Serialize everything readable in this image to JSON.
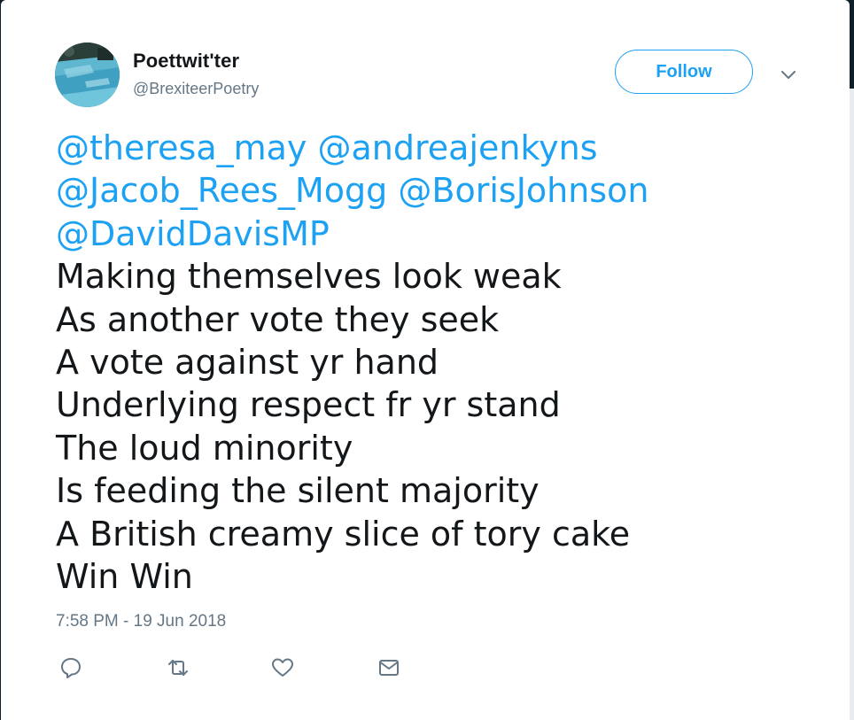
{
  "tweet": {
    "user": {
      "display_name": "Poettwit'ter",
      "screen_name": "@BrexiteerPoetry",
      "avatar_icon": "pool-photo-avatar"
    },
    "follow_label": "Follow",
    "mentions": [
      "@theresa_may",
      "@andreajenkyns",
      "@Jacob_Rees_Mogg",
      "@BorisJohnson",
      "@DavidDavisMP"
    ],
    "lines": [
      "Making themselves look weak",
      "As another vote they seek",
      "A vote against yr hand",
      "Underlying respect fr yr stand",
      "The loud minority",
      "Is feeding the silent majority",
      "A British creamy slice of tory cake",
      "Win Win"
    ],
    "timestamp": "7:58 PM - 19 Jun 2018",
    "actions": [
      "reply-icon",
      "retweet-icon",
      "like-icon",
      "direct-message-icon"
    ]
  },
  "colors": {
    "accent": "#1da1f2",
    "text": "#14171a",
    "secondary_text": "#657786",
    "background": "#0f1f29"
  }
}
